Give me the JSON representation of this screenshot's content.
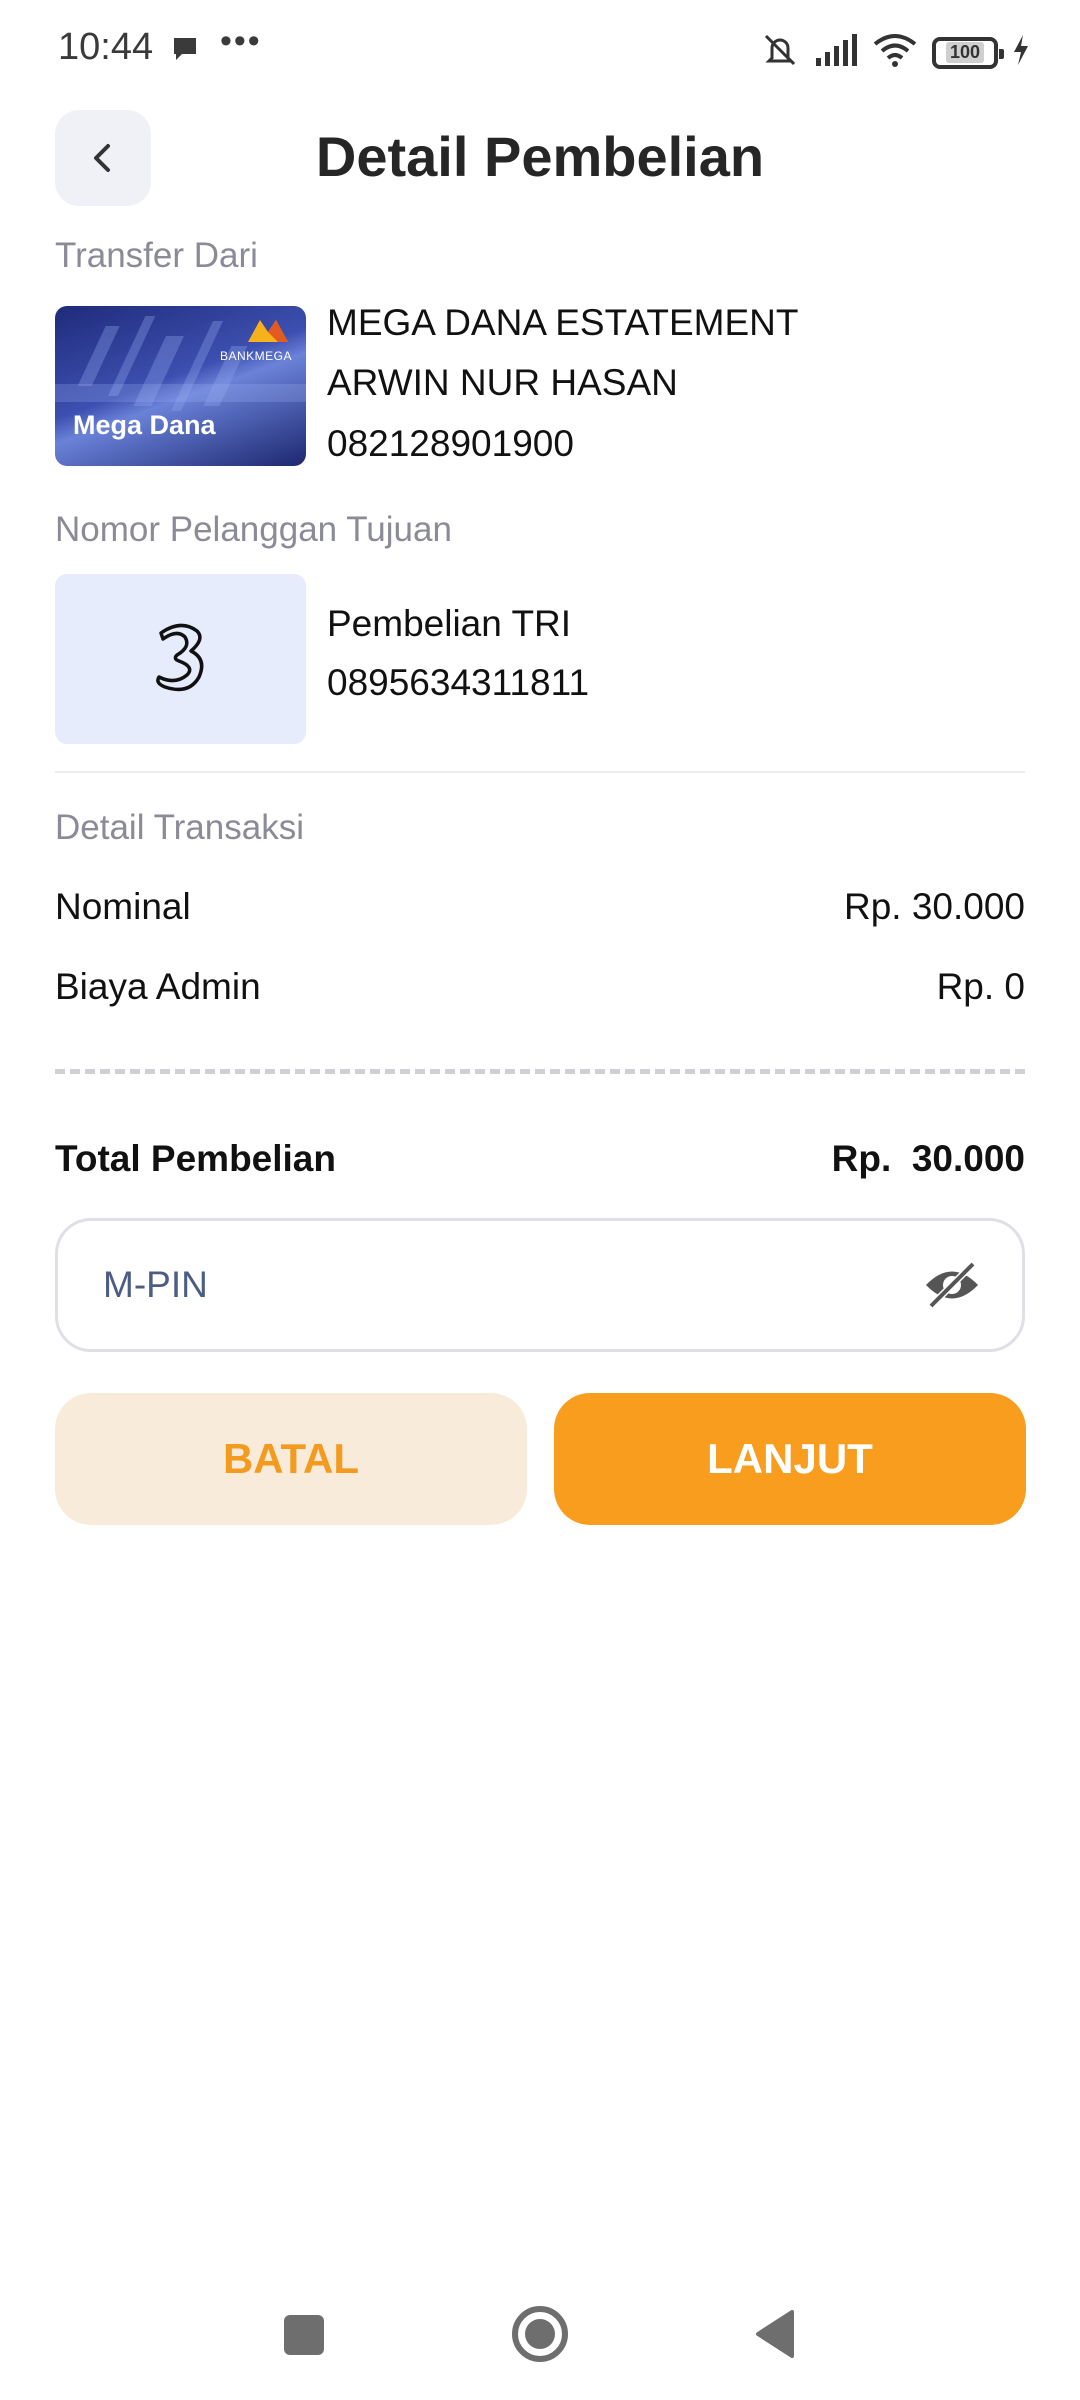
{
  "status_bar": {
    "time": "10:44",
    "more": "•••",
    "battery": "100",
    "icons": [
      "chat-icon",
      "mute-icon",
      "signal-icon",
      "wifi-icon",
      "battery-icon",
      "charging-icon"
    ]
  },
  "header": {
    "title": "Detail Pembelian",
    "back_icon": "chevron-left-icon"
  },
  "source": {
    "label": "Transfer Dari",
    "card_label": "Mega Dana",
    "bank_name": "BANKMEGA",
    "account_name": "MEGA DANA ESTATEMENT",
    "holder_name": "ARWIN NUR HASAN",
    "account_number": "082128901900"
  },
  "destination": {
    "label": "Nomor Pelanggan Tujuan",
    "provider_icon": "tri-logo-icon",
    "product": "Pembelian TRI",
    "number": "0895634311811"
  },
  "transaction": {
    "label": "Detail Transaksi",
    "rows": [
      {
        "label": "Nominal",
        "value": "Rp. 30.000"
      },
      {
        "label": "Biaya Admin",
        "value": "Rp. 0"
      }
    ],
    "total_label": "Total Pembelian",
    "total_value": "Rp.  30.000"
  },
  "pin": {
    "placeholder": "M-PIN",
    "toggle_icon": "eye-off-icon"
  },
  "buttons": {
    "cancel": "BATAL",
    "next": "LANJUT"
  },
  "colors": {
    "accent": "#f89d1e",
    "cancel_bg": "#f9ebd9",
    "muted_label": "#8b8b98"
  }
}
